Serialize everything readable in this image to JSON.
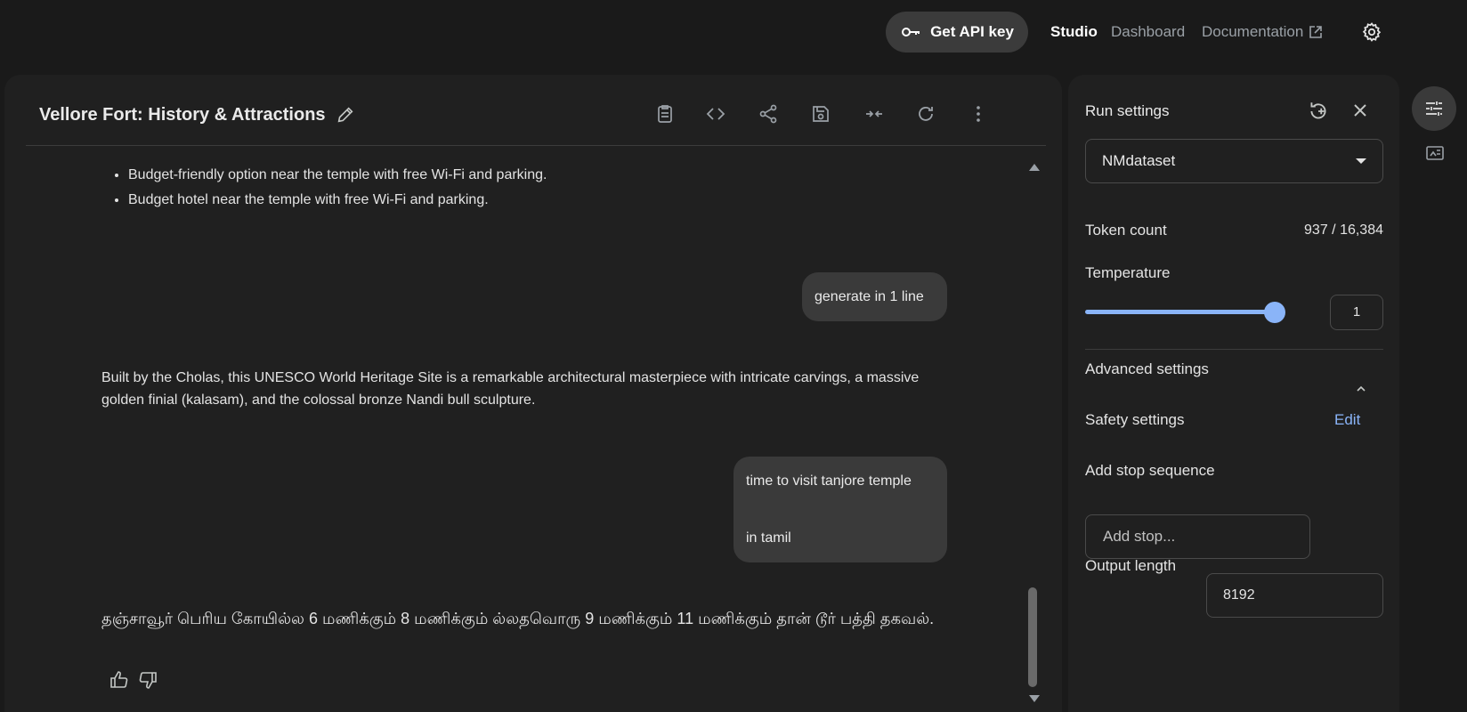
{
  "header": {
    "api_key_label": "Get API key",
    "nav_studio": "Studio",
    "nav_dashboard": "Dashboard",
    "nav_documentation": "Documentation"
  },
  "chat": {
    "title": "Vellore Fort: History & Attractions",
    "bullets": [
      "Budget-friendly option near the temple with free Wi-Fi and parking.",
      "Budget hotel near the temple with free Wi-Fi and parking."
    ],
    "user_message_1": "generate in 1 line",
    "model_response_1": "Built by the Cholas, this UNESCO World Heritage Site is a remarkable architectural masterpiece with intricate carvings, a massive golden finial (kalasam), and the colossal bronze Nandi bull sculpture.",
    "user_message_2_line1": "time to visit tanjore temple",
    "user_message_2_line2": "in tamil",
    "model_response_2": "தஞ்சாவூர் பெரிய கோயில்ல 6 மணிக்கும் 8 மணிக்கும் ல்லதவொரு 9 மணிக்கும் 11 மணிக்கும் தான் டூர் பத்தி தகவல்."
  },
  "run_settings": {
    "title": "Run settings",
    "model": "NMdataset",
    "token_count_label": "Token count",
    "token_count_value": "937 / 16,384",
    "temperature_label": "Temperature",
    "temperature_value": "1",
    "temperature_fraction": 0.5,
    "advanced_label": "Advanced settings",
    "safety_label": "Safety settings",
    "safety_edit": "Edit",
    "stop_label": "Add stop sequence",
    "stop_placeholder": "Add stop...",
    "output_length_label": "Output length",
    "output_length_value": "8192"
  },
  "colors": {
    "accent": "#8ab4f8",
    "background": "#1a1a1a",
    "panel": "#202020",
    "user_bubble": "#3a3a3a"
  },
  "icons": [
    "key-icon",
    "external-link-icon",
    "gear-icon",
    "edit-icon",
    "clipboard-icon",
    "code-icon",
    "share-icon",
    "save-icon",
    "compare-icon",
    "refresh-icon",
    "more-vert-icon",
    "thumbs-up-icon",
    "thumbs-down-icon",
    "reset-icon",
    "close-icon",
    "tune-icon",
    "image-icon"
  ]
}
